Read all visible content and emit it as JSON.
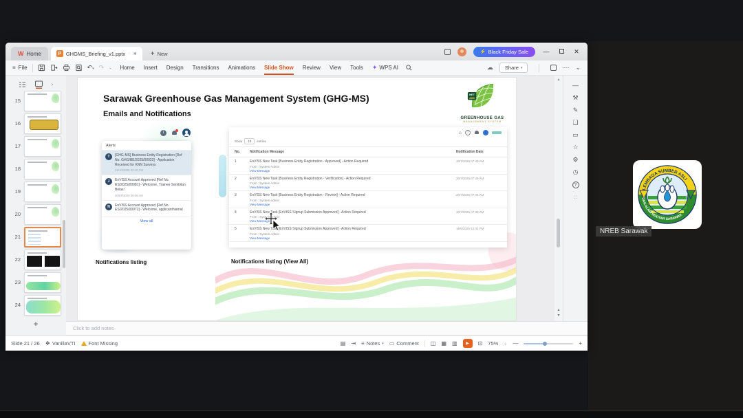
{
  "meeting": {
    "participant_label": "NREB Sarawak"
  },
  "wps": {
    "tab_home": "Home",
    "doc_title": "GHGMS_Briefing_v1.pptx",
    "new_tab": "New",
    "promo": "Black Friday Sale",
    "file": "File",
    "menus": [
      "Home",
      "Insert",
      "Design",
      "Transitions",
      "Animations",
      "Slide Show",
      "Review",
      "View",
      "Tools"
    ],
    "wps_ai": "WPS AI",
    "share": "Share"
  },
  "sidebar": {
    "slide_numbers": [
      "15",
      "16",
      "17",
      "18",
      "19",
      "20",
      "21",
      "22",
      "23",
      "24"
    ],
    "add_slide": "+"
  },
  "slide": {
    "title": "Sarawak Greenhouse Gas Management System (GHG-MS)",
    "subtitle": "Emails and Notifications",
    "logo": {
      "line1": "GREENHOUSE GAS",
      "line2": "MANAGEMENT SYSTEM",
      "badge_top": "NET",
      "badge_bottom": "2050"
    },
    "captions": {
      "left": "Notifications listing",
      "right": "Notifications listing (View All)"
    },
    "alerts": {
      "title": "Alerts",
      "view_all": "View all",
      "items": [
        {
          "initial": "T",
          "text": "[GHG-MS] Business Entity Registration [Ref No. GHG/BE/2025/00023] - Application Received for KNN Surveys",
          "date": "21/10/2025 02:19 PM"
        },
        {
          "initial": "J",
          "text": "EnVISS Account Approved [Ref No. ES/2025/00081] - Welcome, Trainee Sembilan Belas!",
          "date": "30/07/2025 09:09 AM"
        },
        {
          "initial": "N",
          "text": "EnVISS Account Approved [Ref No. ES/2025/00072] - Welcome, applicanthiamal",
          "date": ""
        }
      ]
    },
    "table": {
      "show_label": "Show",
      "page_size": "10",
      "entries_label": "entries",
      "headers": {
        "no": "No.",
        "message": "Notification Message",
        "date": "Notification Date"
      },
      "rows": [
        {
          "no": "1",
          "message": "EnVISS New Task [Business Entity Registration - Approved] - Action Required",
          "from": "From : System Admin",
          "link": "View Message",
          "date": "30/7/2025 07:49 AM"
        },
        {
          "no": "2",
          "message": "EnVISS New Task [Business Entity Registration - Verification] - Action Required",
          "from": "From : System Admin",
          "link": "View Message",
          "date": "30/7/2025 07:49 AM"
        },
        {
          "no": "3",
          "message": "EnVISS New Task [Business Entity Registration - Review] - Action Required",
          "from": "From : System Admin",
          "link": "View Message",
          "date": "30/7/2025 07:46 AM"
        },
        {
          "no": "4",
          "message": "EnVISS New Task [EnVISS Signup Submission Approved] - Action Required",
          "from": "From : System Admin",
          "link": "View Message",
          "date": "30/7/2025 07:39 AM"
        },
        {
          "no": "5",
          "message": "EnVISS New Task [EnVISS Signup Submission Approved] - Action Required",
          "from": "From : System Admin",
          "link": "View Message",
          "date": "16/6/2025 12:41 PM"
        }
      ]
    }
  },
  "notes": {
    "placeholder": "Click to add notes"
  },
  "status": {
    "slide_counter": "Slide 21 / 26",
    "theme_name": "VanillaVTI",
    "font_missing": "Font Missing",
    "notes_label": "Notes",
    "comment_label": "Comment",
    "zoom_level": "75%"
  },
  "colors": {
    "wps_accent": "#d4511e",
    "link_blue": "#2f6fd6",
    "promo_start": "#3a7bf0",
    "promo_end": "#8a4df0",
    "play_orange": "#e8611c"
  }
}
